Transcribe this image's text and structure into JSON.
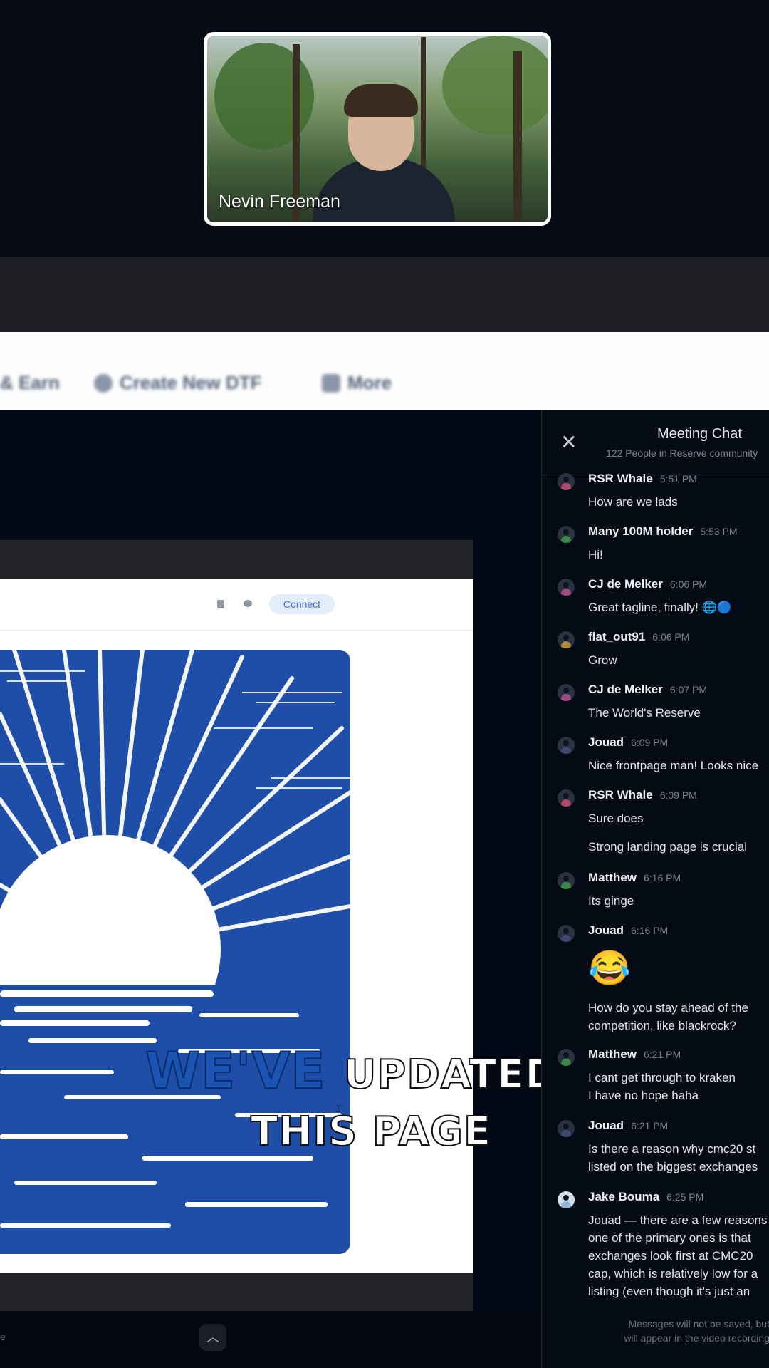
{
  "video": {
    "participant_name": "Nevin Freeman"
  },
  "browser": {
    "tabs": [
      {
        "icon": "earn-icon",
        "label": "& Earn"
      },
      {
        "icon": "create-icon",
        "label": "Create New DTF"
      },
      {
        "icon": "grid-icon",
        "label": "More"
      }
    ]
  },
  "site": {
    "connect_label": "Connect"
  },
  "caption": {
    "highlight": "WE'VE",
    "rest": "UPDATED",
    "line2": "THIS PAGE"
  },
  "chat": {
    "close_label": "✕",
    "title": "Meeting Chat",
    "subtitle": "122 People in Reserve community",
    "messages": [
      {
        "author": "RSR Whale",
        "time": "5:51 PM",
        "text": "How are we lads",
        "accent": "#b24a6a"
      },
      {
        "author": "Many 100M holder",
        "time": "5:53 PM",
        "text": "Hi!",
        "accent": "#3a8a4a"
      },
      {
        "author": "CJ de Melker",
        "time": "6:06 PM",
        "text": "Great tagline, finally! 🌐🔵",
        "accent": "#a04a86"
      },
      {
        "author": "flat_out91",
        "time": "6:06 PM",
        "text": "Grow",
        "accent": "#b08a3a"
      },
      {
        "author": "CJ de Melker",
        "time": "6:07 PM",
        "text": "The World's Reserve",
        "accent": "#a04a86"
      },
      {
        "author": "Jouad",
        "time": "6:09 PM",
        "text": "Nice frontpage man! Looks nice",
        "accent": "#3a4a70"
      },
      {
        "author": "RSR Whale",
        "time": "6:09 PM",
        "text": "Sure does",
        "extra": "Strong landing page is crucial",
        "accent": "#b24a6a"
      },
      {
        "author": "Matthew",
        "time": "6:16 PM",
        "text": "Its ginge",
        "accent": "#3a8a4a"
      },
      {
        "author": "Jouad",
        "time": "6:16 PM",
        "emoji": "😂",
        "extra1": "How do you stay ahead of the",
        "extra2": "competition, like blackrock?",
        "accent": "#3a4a70"
      },
      {
        "author": "Matthew",
        "time": "6:21 PM",
        "line1": "I cant get through to kraken",
        "line2": "I have no hope haha",
        "accent": "#3a8a4a"
      },
      {
        "author": "Jouad",
        "time": "6:21 PM",
        "line1": "Is there a reason why cmc20 st",
        "line2": "listed on the biggest exchanges",
        "accent": "#3a4a70"
      },
      {
        "author": "Jake Bouma",
        "time": "6:25 PM",
        "line1": "Jouad — there are a few reasons",
        "line2": "one of the primary ones is that",
        "line3": "exchanges look first at CMC20",
        "line4": "cap, which is relatively low for a",
        "line5": "listing (even though it's just an",
        "accent": "#8fb6d8"
      }
    ],
    "footer_line1": "Messages will not be saved, but",
    "footer_line2": "will appear in the video recording"
  }
}
